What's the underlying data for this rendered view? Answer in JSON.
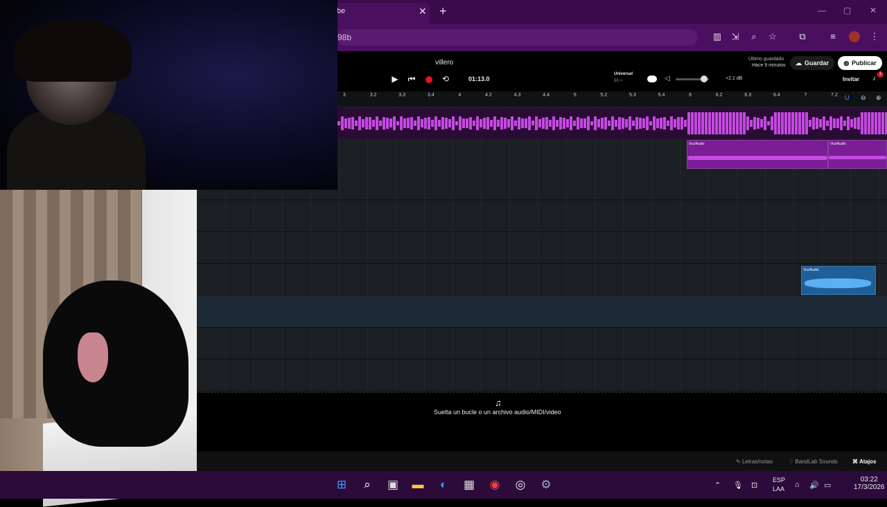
{
  "browser": {
    "tab_title": "be",
    "tab_close": "✕",
    "new_tab": "+",
    "url_fragment": "98b",
    "window_controls": [
      "—",
      "▢",
      "✕"
    ]
  },
  "app": {
    "project_name": "villero",
    "last_saved_label": "Último guardado",
    "last_saved_time": "Hace 9 minutos",
    "save_label": "Guardar",
    "publish_label": "Publicar",
    "invite_label": "Invitar",
    "notification_count": "1",
    "time_display": "01:13.0",
    "metronome_label": "Universal",
    "metronome_sub": "50 >",
    "volume_db": "+2.1 dB",
    "volume_level": 0.75,
    "ruler_ticks": [
      "3",
      "3.2",
      "3.3",
      "3.4",
      "4",
      "4.2",
      "4.3",
      "4.4",
      "5",
      "5.2",
      "5.3",
      "5.4",
      "6",
      "6.2",
      "6.3",
      "6.4",
      "7",
      "7.2"
    ],
    "clips": [
      {
        "label": "Voz/Audio"
      },
      {
        "label": "Voz/Audio"
      },
      {
        "label": "Voz/Audio"
      }
    ],
    "drop_text": "Suelta un bucle o un archivo audio/MIDI/video",
    "footer": {
      "lyrics": "Letras/notas",
      "sounds": "BandLab Sounds",
      "shortcuts": "Atajos"
    }
  },
  "taskbar": {
    "lang1": "ESP",
    "lang2": "LAA",
    "time": "03:22",
    "date": "17/3/2026"
  },
  "colors": {
    "accent_purple": "#c44ae0",
    "clip_blue": "#3b8fd6",
    "record_red": "#e0141e"
  }
}
